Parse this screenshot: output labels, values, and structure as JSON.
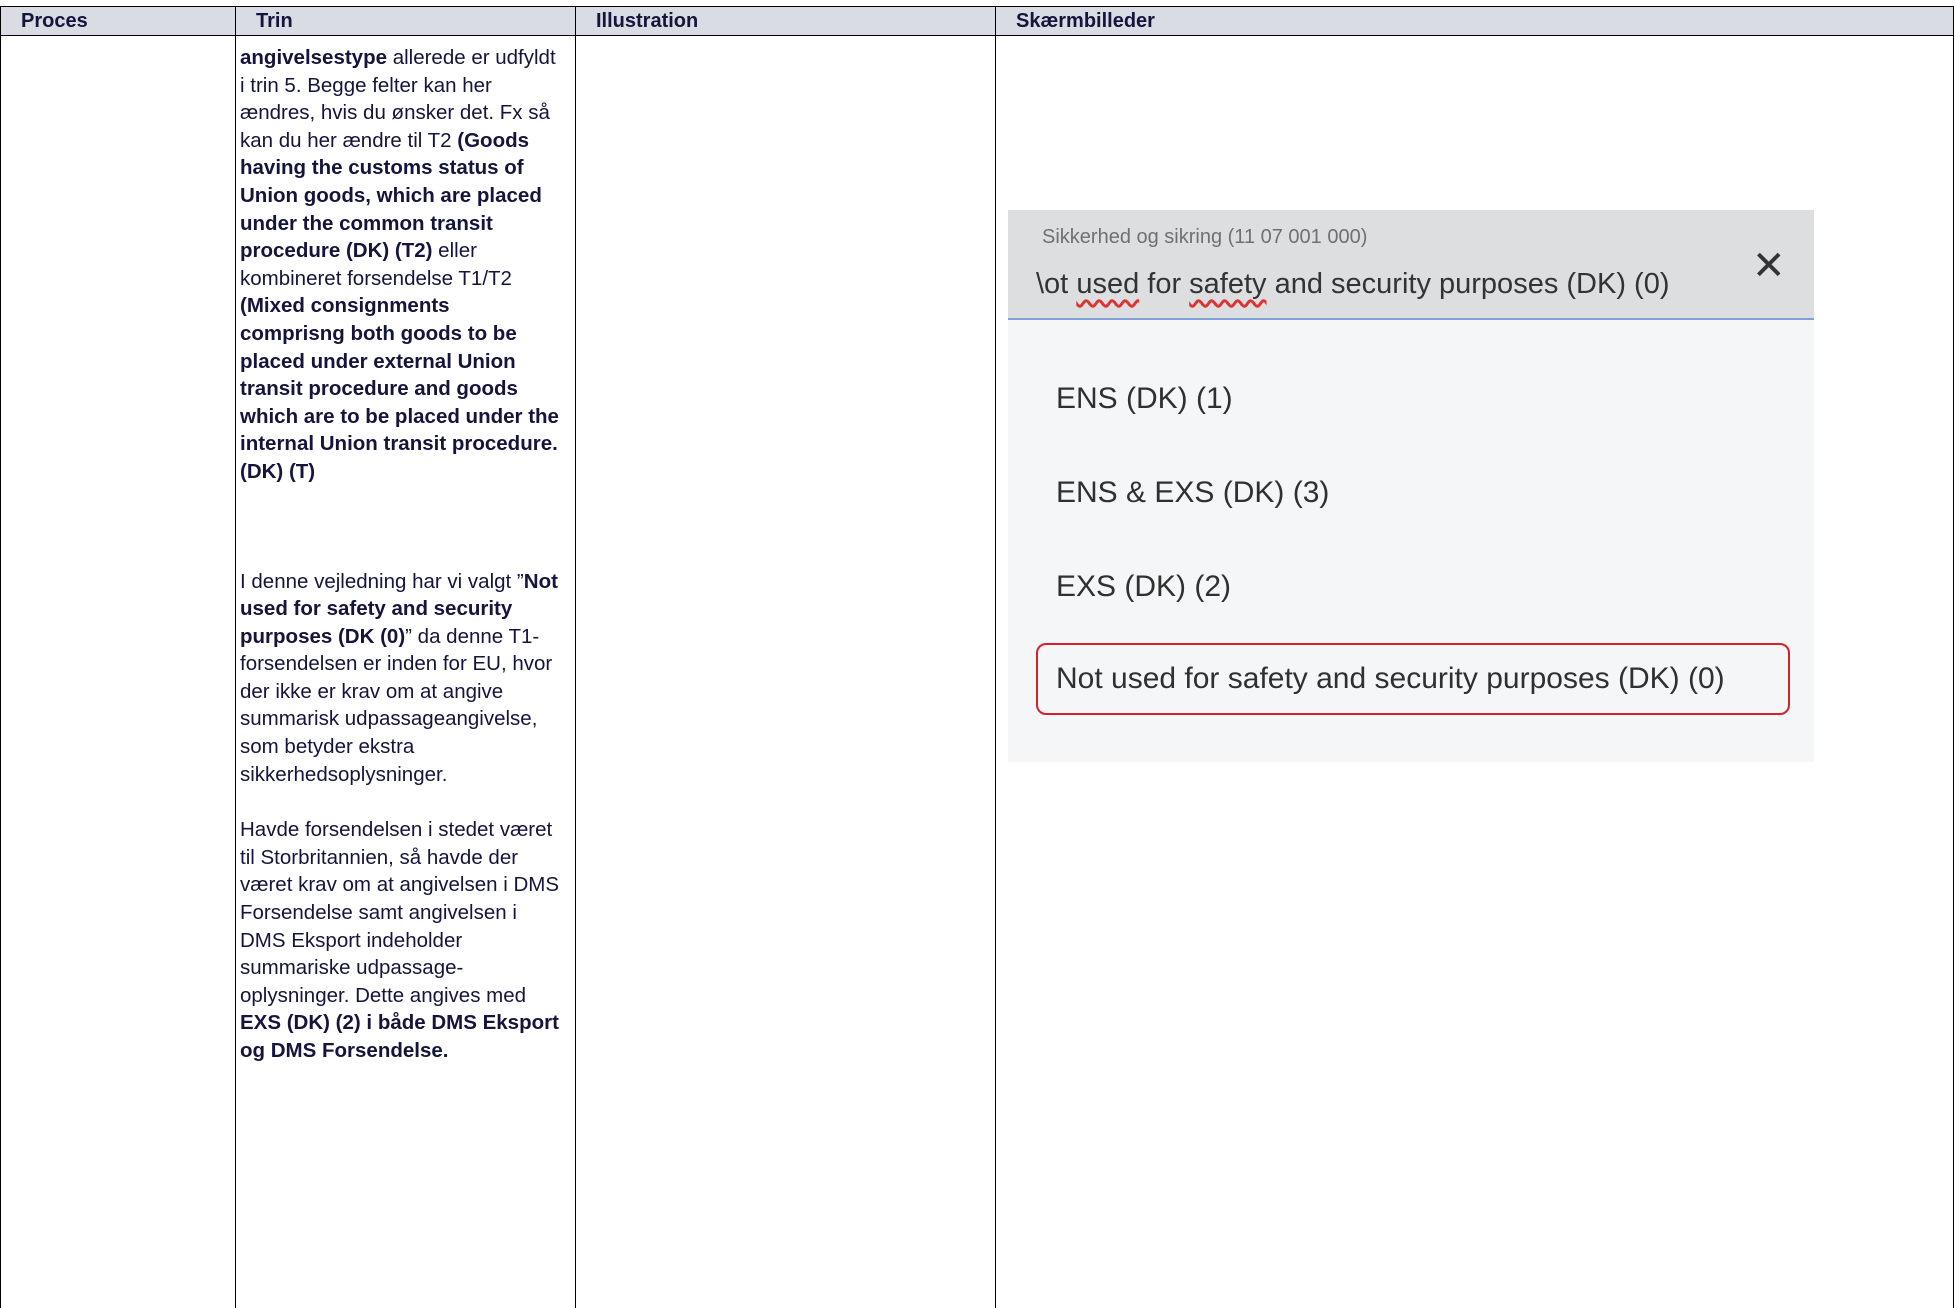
{
  "headers": {
    "proces": "Proces",
    "trin": "Trin",
    "illustration": "Illustration",
    "skaermbilleder": "Skærmbilleder"
  },
  "trin": {
    "p1_b1": "angivelsestype",
    "p1_t1": " allerede er udfyldt i trin 5. Begge felter kan her ændres, hvis du ønsker det. Fx så kan du her ændre til T2 ",
    "p1_b2": "(Goods having the customs status of Union goods, which are placed under the common transit procedure (DK) (T2)",
    "p1_t2": " eller kombineret forsendelse T1/T2 ",
    "p1_b3": "(Mixed consignments comprisng both goods to be placed under external Union transit procedure and goods which are to be placed under the internal Union transit procedure. (DK) (T)",
    "p2_t1": "I denne vejledning har vi valgt ”",
    "p2_b1": "Not used for safety and security purposes (DK (0)",
    "p2_t2": "” da denne T1-forsendelsen er inden for EU, hvor der ikke er krav om at angive summarisk udpassageangivelse, som betyder ekstra sikkerhedsoplysninger.",
    "p3_t1": "Havde forsendelsen i stedet været til Storbritannien, så havde der været krav om at angivelsen i DMS Forsendelse samt angivelsen i DMS Eksport indeholder summariske udpassage-oplysninger. Dette angives med ",
    "p3_b1": "EXS (DK) (2) i både DMS Eksport og DMS Forsendelse."
  },
  "screenshot": {
    "field_label": "Sikkerhed og sikring (11 07 001 000)",
    "value_pre": "\\ot ",
    "value_w1": "used",
    "value_mid": " for ",
    "value_w2": "safety",
    "value_post": " and security purposes (DK) (0)",
    "close_glyph": "✕",
    "options": [
      "ENS (DK) (1)",
      "ENS & EXS (DK) (3)",
      "EXS (DK) (2)",
      "Not used for safety and security purposes (DK) (0)"
    ],
    "highlight_color": "#d8202c"
  }
}
